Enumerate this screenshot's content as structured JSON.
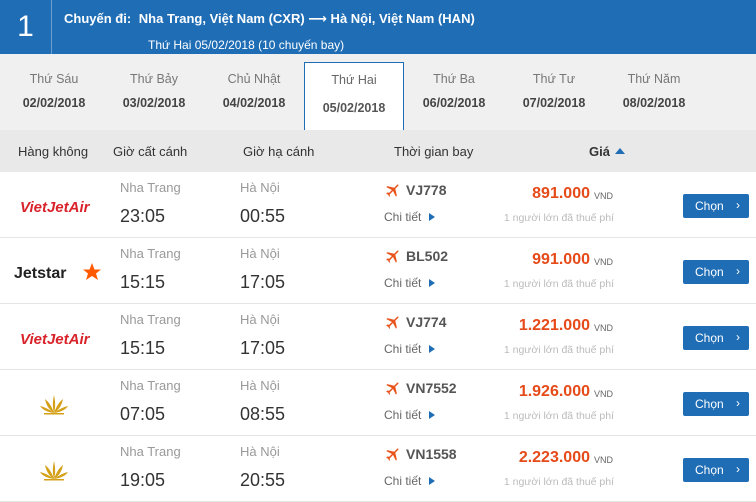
{
  "header": {
    "step": "1",
    "label": "Chuyến đi:",
    "route": "Nha Trang, Việt Nam (CXR) ⟶ Hà Nội, Việt Nam (HAN)",
    "subtitle": "Thứ Hai 05/02/2018 (10 chuyến bay)",
    "bg_color": "#1f6db5"
  },
  "dates": [
    {
      "dow": "Thứ Sáu",
      "date": "02/02/2018",
      "active": false
    },
    {
      "dow": "Thứ Bảy",
      "date": "03/02/2018",
      "active": false
    },
    {
      "dow": "Chủ Nhật",
      "date": "04/02/2018",
      "active": false
    },
    {
      "dow": "Thứ Hai",
      "date": "05/02/2018",
      "active": true
    },
    {
      "dow": "Thứ Ba",
      "date": "06/02/2018",
      "active": false
    },
    {
      "dow": "Thứ Tư",
      "date": "07/02/2018",
      "active": false
    },
    {
      "dow": "Thứ Năm",
      "date": "08/02/2018",
      "active": false
    }
  ],
  "columns": {
    "airline": "Hàng không",
    "depart": "Giờ cất cánh",
    "arrive": "Giờ hạ cánh",
    "duration": "Thời gian bay",
    "price": "Giá"
  },
  "flights": [
    {
      "airline": "vietjet",
      "airline_text": "VietJetAir",
      "from_city": "Nha Trang",
      "dep": "23:05",
      "to_city": "Hà Nội",
      "arr": "00:55",
      "flight_no": "VJ778",
      "detail": "Chi tiết",
      "price": "891.000",
      "currency": "VND",
      "note": "1 người lớn đã thuế phí",
      "button": "Chọn"
    },
    {
      "airline": "jetstar",
      "airline_text": "Jetstar",
      "from_city": "Nha Trang",
      "dep": "15:15",
      "to_city": "Hà Nội",
      "arr": "17:05",
      "flight_no": "BL502",
      "detail": "Chi tiết",
      "price": "991.000",
      "currency": "VND",
      "note": "1 người lớn đã thuế phí",
      "button": "Chọn"
    },
    {
      "airline": "vietjet",
      "airline_text": "VietJetAir",
      "from_city": "Nha Trang",
      "dep": "15:15",
      "to_city": "Hà Nội",
      "arr": "17:05",
      "flight_no": "VJ774",
      "detail": "Chi tiết",
      "price": "1.221.000",
      "currency": "VND",
      "note": "1 người lớn đã thuế phí",
      "button": "Chọn"
    },
    {
      "airline": "vietnam-airlines",
      "airline_text": "",
      "from_city": "Nha Trang",
      "dep": "07:05",
      "to_city": "Hà Nội",
      "arr": "08:55",
      "flight_no": "VN7552",
      "detail": "Chi tiết",
      "price": "1.926.000",
      "currency": "VND",
      "note": "1 người lớn đã thuế phí",
      "button": "Chọn"
    },
    {
      "airline": "vietnam-airlines",
      "airline_text": "",
      "from_city": "Nha Trang",
      "dep": "19:05",
      "to_city": "Hà Nội",
      "arr": "20:55",
      "flight_no": "VN1558",
      "detail": "Chi tiết",
      "price": "2.223.000",
      "currency": "VND",
      "note": "1 người lớn đã thuế phí",
      "button": "Chọn"
    }
  ],
  "colors": {
    "primary": "#1f6db5",
    "price": "#e64a19",
    "plane_icon": "#e8541c",
    "vietjet_red": "#d9232b",
    "jetstar_orange": "#ff5a00",
    "vna_gold": "#d4a017"
  }
}
